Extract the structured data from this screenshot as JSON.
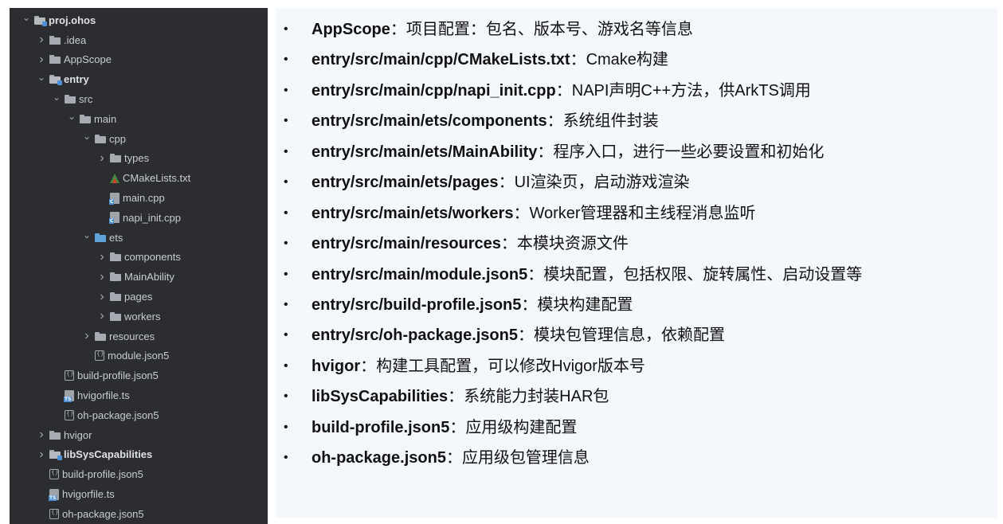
{
  "tree": [
    {
      "label": "proj.ohos",
      "depth": 0,
      "arrow": "down",
      "icon": "folder-module",
      "bold": true
    },
    {
      "label": ".idea",
      "depth": 1,
      "arrow": "right",
      "icon": "folder"
    },
    {
      "label": "AppScope",
      "depth": 1,
      "arrow": "right",
      "icon": "folder"
    },
    {
      "label": "entry",
      "depth": 1,
      "arrow": "down",
      "icon": "folder-module",
      "bold": true
    },
    {
      "label": "src",
      "depth": 2,
      "arrow": "down",
      "icon": "folder"
    },
    {
      "label": "main",
      "depth": 3,
      "arrow": "down",
      "icon": "folder"
    },
    {
      "label": "cpp",
      "depth": 4,
      "arrow": "down",
      "icon": "folder"
    },
    {
      "label": "types",
      "depth": 5,
      "arrow": "right",
      "icon": "folder"
    },
    {
      "label": "CMakeLists.txt",
      "depth": 5,
      "arrow": "none",
      "icon": "cmake"
    },
    {
      "label": "main.cpp",
      "depth": 5,
      "arrow": "none",
      "icon": "cpp"
    },
    {
      "label": "napi_init.cpp",
      "depth": 5,
      "arrow": "none",
      "icon": "cpp"
    },
    {
      "label": "ets",
      "depth": 4,
      "arrow": "down",
      "icon": "folder-blue"
    },
    {
      "label": "components",
      "depth": 5,
      "arrow": "right",
      "icon": "folder"
    },
    {
      "label": "MainAbility",
      "depth": 5,
      "arrow": "right",
      "icon": "folder"
    },
    {
      "label": "pages",
      "depth": 5,
      "arrow": "right",
      "icon": "folder"
    },
    {
      "label": "workers",
      "depth": 5,
      "arrow": "right",
      "icon": "folder"
    },
    {
      "label": "resources",
      "depth": 4,
      "arrow": "right",
      "icon": "folder"
    },
    {
      "label": "module.json5",
      "depth": 4,
      "arrow": "none",
      "icon": "json"
    },
    {
      "label": "build-profile.json5",
      "depth": 2,
      "arrow": "none",
      "icon": "json"
    },
    {
      "label": "hvigorfile.ts",
      "depth": 2,
      "arrow": "none",
      "icon": "ts"
    },
    {
      "label": "oh-package.json5",
      "depth": 2,
      "arrow": "none",
      "icon": "json"
    },
    {
      "label": "hvigor",
      "depth": 1,
      "arrow": "right",
      "icon": "folder"
    },
    {
      "label": "libSysCapabilities",
      "depth": 1,
      "arrow": "right",
      "icon": "folder-module",
      "bold": true
    },
    {
      "label": "build-profile.json5",
      "depth": 1,
      "arrow": "none",
      "icon": "json"
    },
    {
      "label": "hvigorfile.ts",
      "depth": 1,
      "arrow": "none",
      "icon": "ts"
    },
    {
      "label": "oh-package.json5",
      "depth": 1,
      "arrow": "none",
      "icon": "json"
    }
  ],
  "descriptions": [
    {
      "path": "AppScope",
      "sep": "：",
      "text": "项目配置：包名、版本号、游戏名等信息"
    },
    {
      "path": "entry/src/main/cpp/CMakeLists.txt",
      "sep": "：",
      "text": "Cmake构建"
    },
    {
      "path": "entry/src/main/cpp/napi_init.cpp",
      "sep": "：",
      "text": "NAPI声明C++方法，供ArkTS调用"
    },
    {
      "path": "entry/src/main/ets/components",
      "sep": "：",
      "text": "系统组件封装"
    },
    {
      "path": "entry/src/main/ets/MainAbility",
      "sep": "：",
      "text": "程序入口，进行一些必要设置和初始化"
    },
    {
      "path": "entry/src/main/ets/pages",
      "sep": "：",
      "text": "UI渲染页，启动游戏渲染"
    },
    {
      "path": "entry/src/main/ets/workers",
      "sep": "：",
      "text": "Worker管理器和主线程消息监听"
    },
    {
      "path": "entry/src/main/resources",
      "sep": "：",
      "text": "本模块资源文件"
    },
    {
      "path": "entry/src/main/module.json5",
      "sep": "：",
      "text": "模块配置，包括权限、旋转属性、启动设置等"
    },
    {
      "path": "entry/src/build-profile.json5",
      "sep": "：",
      "text": "模块构建配置"
    },
    {
      "path": "entry/src/oh-package.json5",
      "sep": "：",
      "text": "模块包管理信息，依赖配置"
    },
    {
      "path": "hvigor",
      "sep": "：",
      "text": "构建工具配置，可以修改Hvigor版本号"
    },
    {
      "path": "libSysCapabilities",
      "sep": "：",
      "text": "系统能力封装HAR包"
    },
    {
      "path": "build-profile.json5",
      "sep": "：",
      "text": "应用级构建配置"
    },
    {
      "path": "oh-package.json5",
      "sep": "：",
      "text": "应用级包管理信息"
    }
  ],
  "bullet": "•"
}
